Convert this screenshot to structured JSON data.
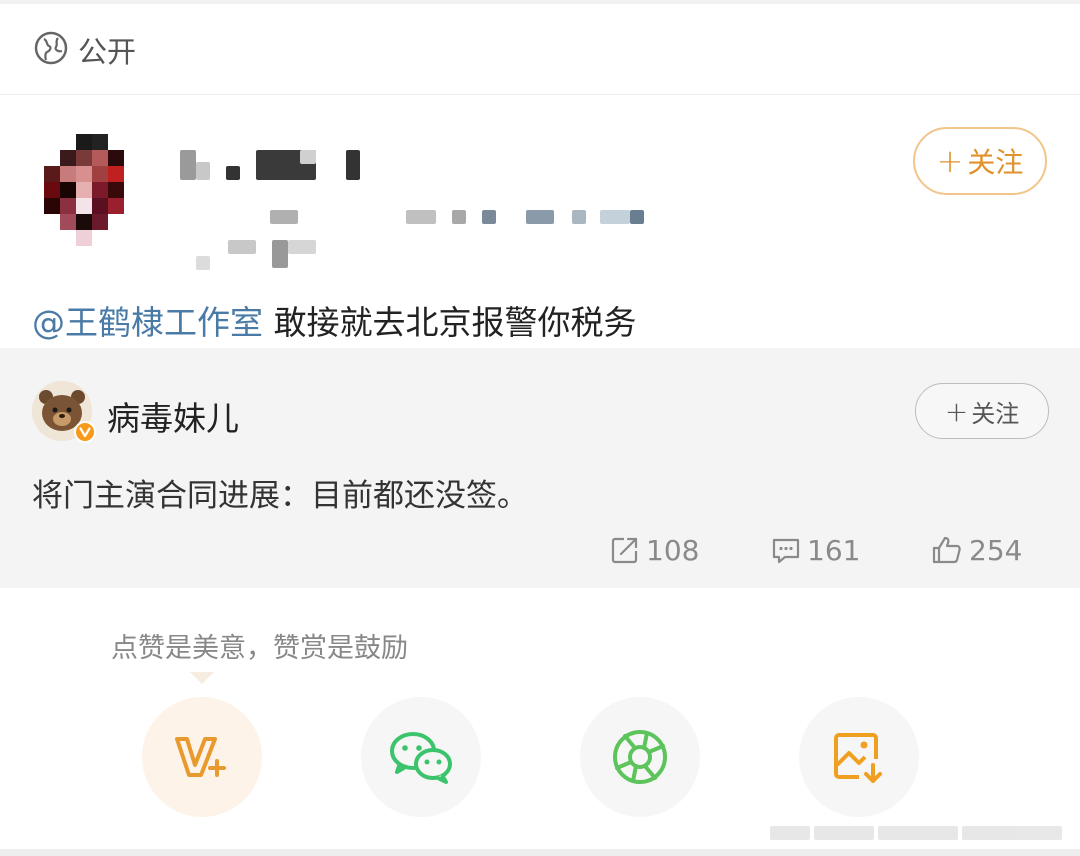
{
  "visibility": {
    "icon": "globe-icon",
    "label": "公开"
  },
  "post": {
    "follow_label": "关注",
    "mention": "@王鹤棣工作室",
    "text": " 敢接就去北京报警你税务"
  },
  "quoted": {
    "author": "病毒妹儿",
    "verified_icon": "verified-badge-icon",
    "follow_label": "关注",
    "text": "将门主演合同进展：目前都还没签。",
    "reposts": "108",
    "comments": "161",
    "likes": "254"
  },
  "encourage_text": "点赞是美意，赞赏是鼓励",
  "share_actions": [
    {
      "name": "reward",
      "icon": "weibo-v-plus-icon"
    },
    {
      "name": "wechat",
      "icon": "wechat-icon"
    },
    {
      "name": "moments",
      "icon": "wechat-moments-icon"
    },
    {
      "name": "save-image",
      "icon": "save-image-icon"
    }
  ],
  "colors": {
    "accent_orange": "#e0922b",
    "mention_blue": "#4a7ba6",
    "wechat_green": "#3cc46c",
    "moments_green": "#5cc45a",
    "save_orange": "#f0a020"
  }
}
